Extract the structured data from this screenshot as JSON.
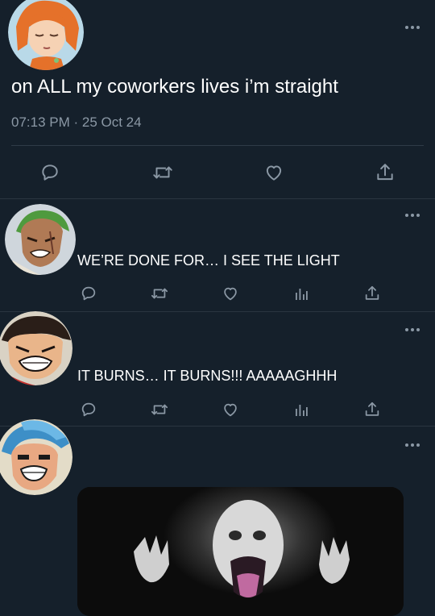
{
  "main_tweet": {
    "text": "on ALL my coworkers lives i’m straight",
    "timestamp": "07:13 PM · 25 Oct 24",
    "avatar_icon": "nami-avatar-icon",
    "actions": [
      "reply-icon",
      "retweet-icon",
      "like-icon",
      "share-icon"
    ]
  },
  "replies": [
    {
      "text": "WE’RE DONE FOR… I SEE THE LIGHT",
      "avatar_icon": "zoro-avatar-icon",
      "actions": [
        "reply-icon",
        "retweet-icon",
        "like-icon",
        "views-icon",
        "share-icon"
      ]
    },
    {
      "text": "IT BURNS… IT BURNS!!! AAAAAGHHH",
      "avatar_icon": "luffy-avatar-icon",
      "actions": [
        "reply-icon",
        "retweet-icon",
        "like-icon",
        "views-icon",
        "share-icon"
      ]
    },
    {
      "text": "",
      "avatar_icon": "franky-avatar-icon",
      "media_icon": "screaming-figure-image",
      "actions": []
    }
  ],
  "colors": {
    "background": "#15202b",
    "text_primary": "#ffffff",
    "text_secondary": "#8b98a5",
    "divider": "#2f3b47"
  }
}
